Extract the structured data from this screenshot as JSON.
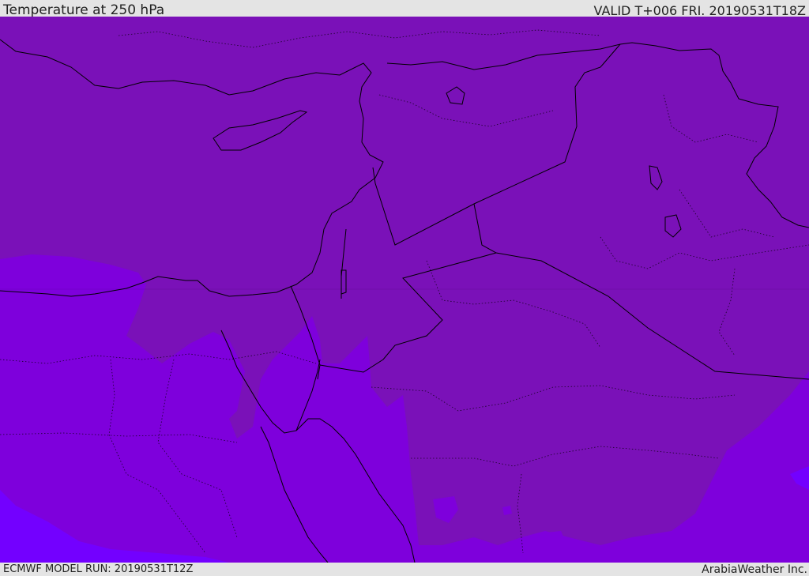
{
  "header": {
    "title": "Temperature at 250 hPa",
    "valid": "VALID T+006 FRI. 20190531T18Z"
  },
  "footer": {
    "model_run": "ECMWF MODEL RUN: 20190531T12Z",
    "credit": "ArabiaWeather Inc."
  },
  "map": {
    "colors": {
      "warm_zone": "#7a11b8",
      "mid_zone": "#7e00dc",
      "cool_zone": "#7300ff",
      "coastline": "#000000",
      "border": "#000000"
    }
  }
}
